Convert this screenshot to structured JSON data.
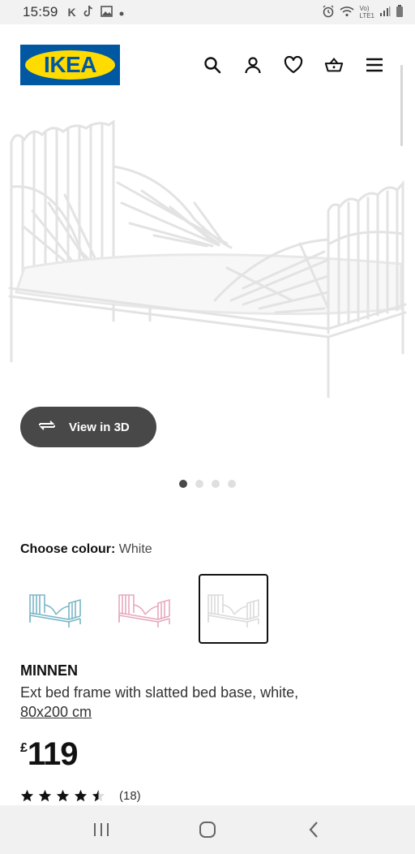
{
  "status_bar": {
    "time": "15:59",
    "app_icons": [
      "k-icon",
      "tiktok-icon",
      "gallery-icon",
      "dot-icon"
    ],
    "letter_k": "K",
    "network_label_top": "Vo)",
    "network_label_bottom": "LTE1"
  },
  "header": {
    "logo_text": "IKEA",
    "icons": [
      "search-icon",
      "user-icon",
      "heart-icon",
      "basket-icon",
      "menu-icon"
    ]
  },
  "gallery": {
    "view3d_label": "View in 3D",
    "dot_count": 4,
    "active_dot": 0
  },
  "colour": {
    "label": "Choose colour:",
    "value": "White",
    "swatches": [
      {
        "name": "blue",
        "color": "#7ab6c7",
        "selected": false
      },
      {
        "name": "pink",
        "color": "#e7a9bd",
        "selected": false
      },
      {
        "name": "white",
        "color": "#e6e6e6",
        "selected": true
      }
    ]
  },
  "product": {
    "name": "MINNEN",
    "description": "Ext bed frame with slatted bed base, white,",
    "size": "80x200 cm",
    "currency": "£",
    "price": "119",
    "rating": 4.5,
    "review_count": "(18)"
  },
  "colors": {
    "brand_blue": "#0058a3",
    "brand_yellow": "#ffdb00",
    "button_dark": "#484848"
  }
}
